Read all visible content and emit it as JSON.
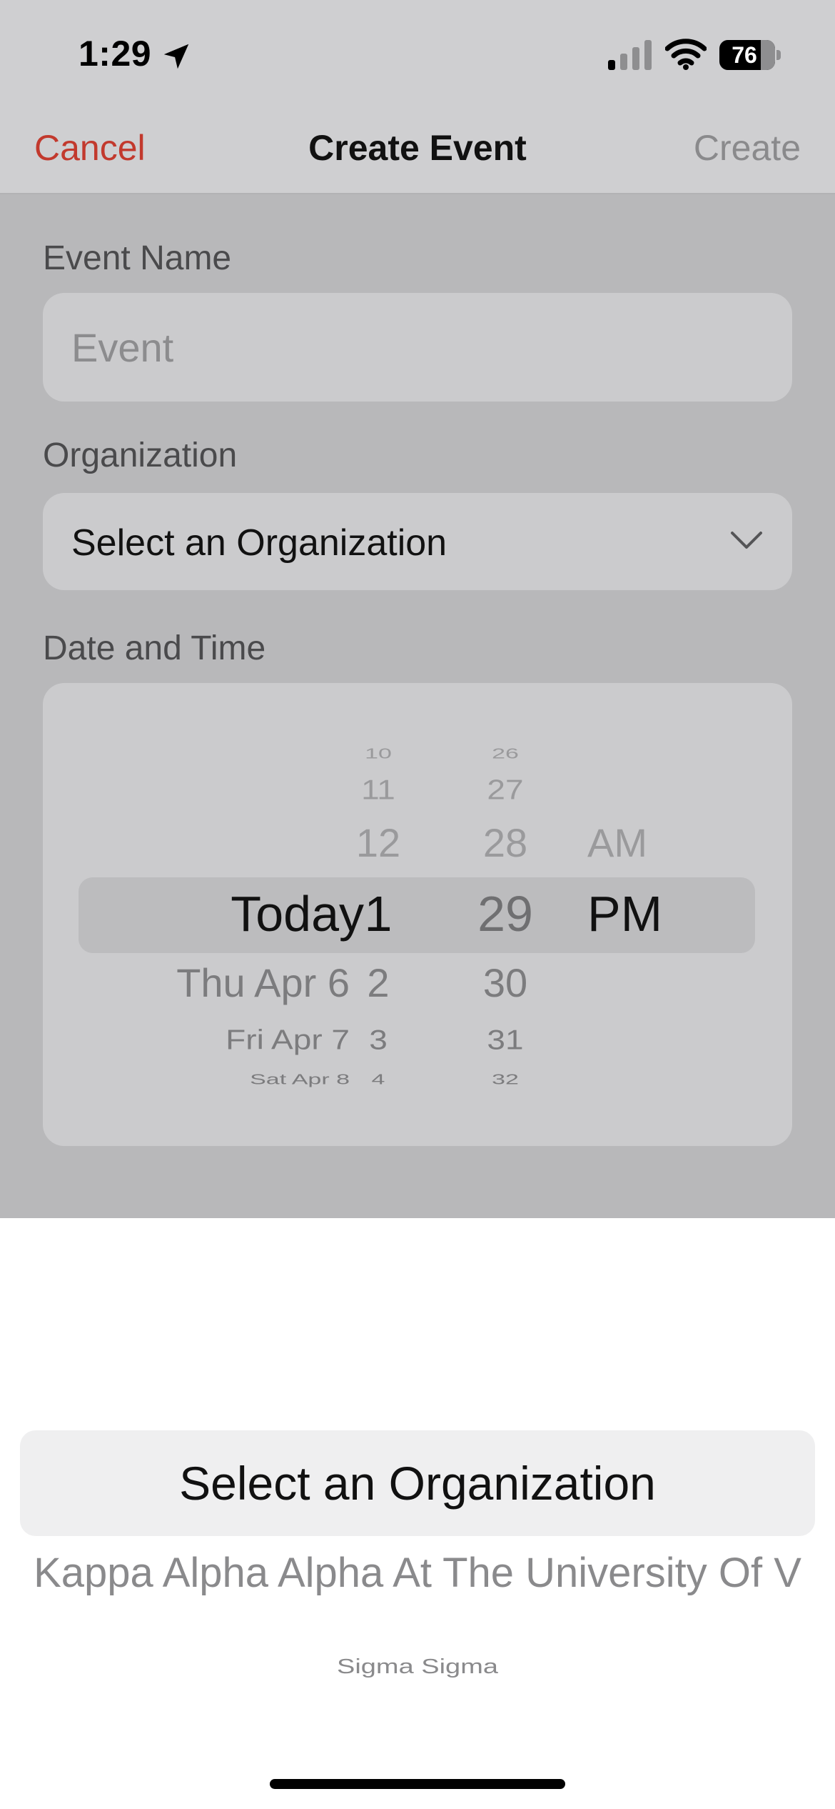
{
  "status_bar": {
    "time": "1:29",
    "battery": "76",
    "icons": [
      "location-arrow-icon",
      "cellular-signal-icon",
      "wifi-icon",
      "battery-icon"
    ]
  },
  "nav": {
    "cancel_label": "Cancel",
    "title": "Create Event",
    "create_label": "Create"
  },
  "form": {
    "event_name": {
      "label": "Event Name",
      "placeholder": "Event",
      "value": ""
    },
    "organization": {
      "label": "Organization",
      "value": "Select an Organization",
      "icon": "chevron-down-icon"
    },
    "date_time": {
      "label": "Date and Time"
    }
  },
  "date_picker": {
    "days": [
      "Today",
      "Thu Apr 6",
      "Fri Apr 7",
      "Sat Apr 8"
    ],
    "hours": [
      "10",
      "11",
      "12",
      "1",
      "2",
      "3",
      "4"
    ],
    "minutes": [
      "26",
      "27",
      "28",
      "29",
      "30",
      "31",
      "32"
    ],
    "periods": [
      "AM",
      "PM"
    ],
    "selected": {
      "day": "Today",
      "hour": "1",
      "minute": "29",
      "period": "PM"
    }
  },
  "org_picker": {
    "title": "Select an Organization",
    "options": [
      "Kappa Alpha Alpha At The University Of V",
      "Sigma Sigma"
    ]
  },
  "colors": {
    "accent_red": "#c2392d",
    "disabled_gray": "#8a8a8c",
    "dim_overlay": "#b8b8ba"
  }
}
